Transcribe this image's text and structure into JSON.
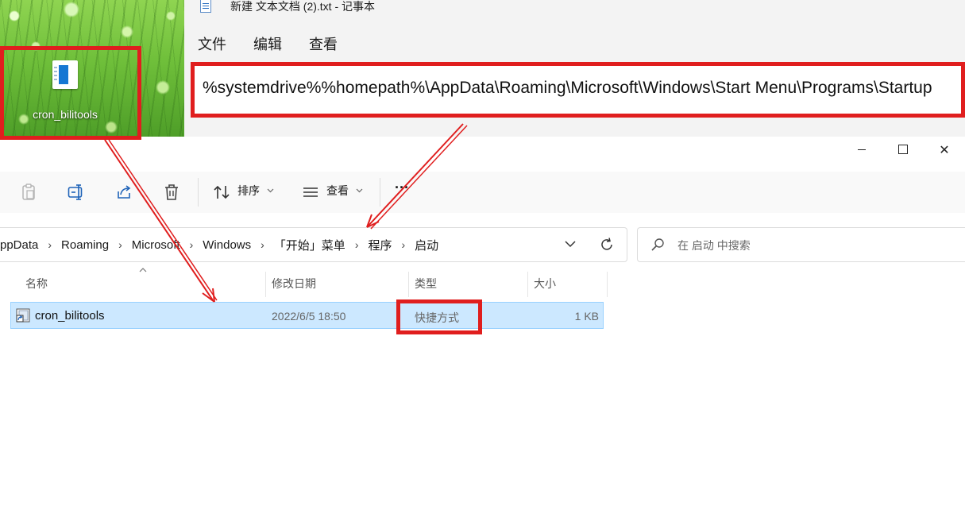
{
  "desktop": {
    "shortcut_label": "cron_bilitools"
  },
  "notepad": {
    "title": "新建 文本文档 (2).txt - 记事本",
    "menu": [
      "文件",
      "编辑",
      "查看"
    ],
    "content": "%systemdrive%%homepath%\\AppData\\Roaming\\Microsoft\\Windows\\Start Menu\\Programs\\Startup"
  },
  "explorer": {
    "window_controls": {
      "close": "✕"
    },
    "toolbar": {
      "sort_label": "排序",
      "view_label": "查看",
      "more_label": "···"
    },
    "breadcrumb": [
      "ppData",
      "Roaming",
      "Microsoft",
      "Windows",
      "「开始」菜单",
      "程序",
      "启动"
    ],
    "search_placeholder": "在 启动 中搜索",
    "columns": {
      "name": "名称",
      "modified": "修改日期",
      "type": "类型",
      "size": "大小"
    },
    "files": [
      {
        "name": "cron_bilitools",
        "modified": "2022/6/5 18:50",
        "type": "快捷方式",
        "size": "1 KB"
      }
    ]
  },
  "annotation_color": "#e01e1e",
  "selection_color": "#cce8ff"
}
